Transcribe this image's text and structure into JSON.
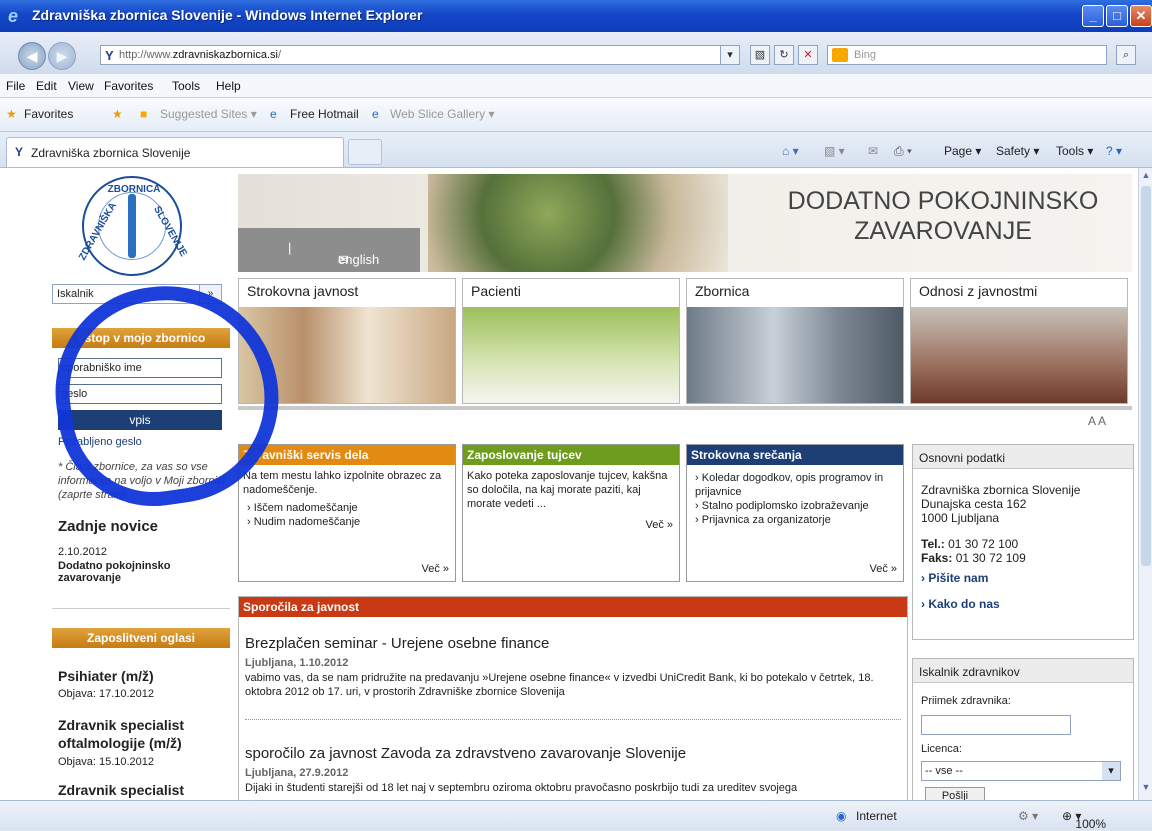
{
  "window": {
    "title": "Zdravniška zbornica Slovenije - Windows Internet Explorer"
  },
  "nav": {
    "url_prefix": "http://www.",
    "url_host": "zdravniskazbornica.si",
    "url_suffix": "/",
    "search_placeholder": "Bing"
  },
  "menu": [
    "File",
    "Edit",
    "View",
    "Favorites",
    "Tools",
    "Help"
  ],
  "favbar": {
    "favorites": "Favorites",
    "suggested": "Suggested Sites ▾",
    "hotmail": "Free Hotmail",
    "slice": "Web Slice Gallery ▾"
  },
  "tab": {
    "title": "Zdravniška zbornica Slovenije"
  },
  "cmd": {
    "page": "Page ▾",
    "safety": "Safety ▾",
    "tools": "Tools ▾"
  },
  "status": {
    "zone": "Internet",
    "zoom": "100%"
  },
  "site": {
    "logo_top": "ZBORNICA",
    "logo_left": "ZDRAVNIŠKA",
    "logo_right": "SLOVENIJE",
    "search_value": "Iskalnik",
    "search_go": "»",
    "login_head": "Vstop v mojo zbornico",
    "username": "uporabniško ime",
    "password": "geslo",
    "login_btn": "vpis",
    "forgot": "Pozabljeno geslo",
    "members_note": "* Člani zbornice, za vas so vse informacije na voljo v Moji zbornici (zaprte strani).",
    "news_head": "Zadnje novice",
    "news_date": "2.10.2012",
    "news_title": "Dodatno pokojninsko zavarovanje",
    "jobs_head": "Zaposlitveni oglasi",
    "jobs": [
      {
        "title": "Psihiater (m/ž)",
        "date": "Objava: 17.10.2012"
      },
      {
        "title": "Zdravnik specialist oftalmologije (m/ž)",
        "date": "Objava: 15.10.2012"
      },
      {
        "title": "Zdravnik specialist",
        "date": ""
      }
    ],
    "banner": "DODATNO POKOJNINSKO ZAVAROVANJE",
    "english": "english",
    "categories": [
      "Strokovna javnost",
      "Pacienti",
      "Zbornica",
      "Odnosi z javnostmi"
    ],
    "font_size": "A A",
    "boxes": [
      {
        "head": "Zdravniški servis dela",
        "text": "Na tem mestu lahko izpolnite obrazec za nadomeščenje.",
        "items": [
          "Iščem nadomeščanje",
          "Nudim nadomeščanje"
        ],
        "more": "Več »",
        "color": "#e28a12"
      },
      {
        "head": "Zaposlovanje tujcev",
        "text": "Kako poteka zaposlovanje tujcev, kakšna so določila, na kaj morate paziti, kaj morate vedeti ...",
        "items": [],
        "more": "Več »",
        "color": "#6e9c1c"
      },
      {
        "head": "Strokovna srečanja",
        "text": "",
        "items": [
          "Koledar dogodkov, opis programov in prijavnice",
          "Stalno podiplomsko izobraževanje",
          "Prijavnica za organizatorje"
        ],
        "more": "Več »",
        "color": "#1d3f76"
      }
    ],
    "press_head": "Sporočila za javnost",
    "press": [
      {
        "title": "Brezplačen seminar - Urejene osebne finance",
        "loc": "Ljubljana, 1.10.2012",
        "body": "vabimo vas, da se nam pridružite na predavanju »Urejene osebne finance« v izvedbi UniCredit Bank, ki bo potekalo v četrtek, 18. oktobra 2012 ob 17. uri, v prostorih Zdravniške zbornice Slovenija"
      },
      {
        "title": "sporočilo za javnost Zavoda za zdravstveno zavarovanje Slovenije",
        "loc": "Ljubljana, 27.9.2012",
        "body": "Dijaki in študenti starejši od 18 let naj v septembru oziroma oktobru pravočasno poskrbijo tudi za ureditev svojega"
      }
    ],
    "basic_head": "Osnovni podatki",
    "org": "Zdravniška zbornica Slovenije",
    "street": "Dunajska cesta 162",
    "city": "1000 Ljubljana",
    "tel_label": "Tel.:",
    "tel": "01 30 72 100",
    "fax_label": "Faks:",
    "fax": "01 30 72 109",
    "write": "Pišite nam",
    "howto": "Kako do nas",
    "doc_head": "Iskalnik zdravnikov",
    "surname_label": "Priimek zdravnika:",
    "licence_label": "Licenca:",
    "licence_value": "-- vse --",
    "send": "Pošlji"
  }
}
